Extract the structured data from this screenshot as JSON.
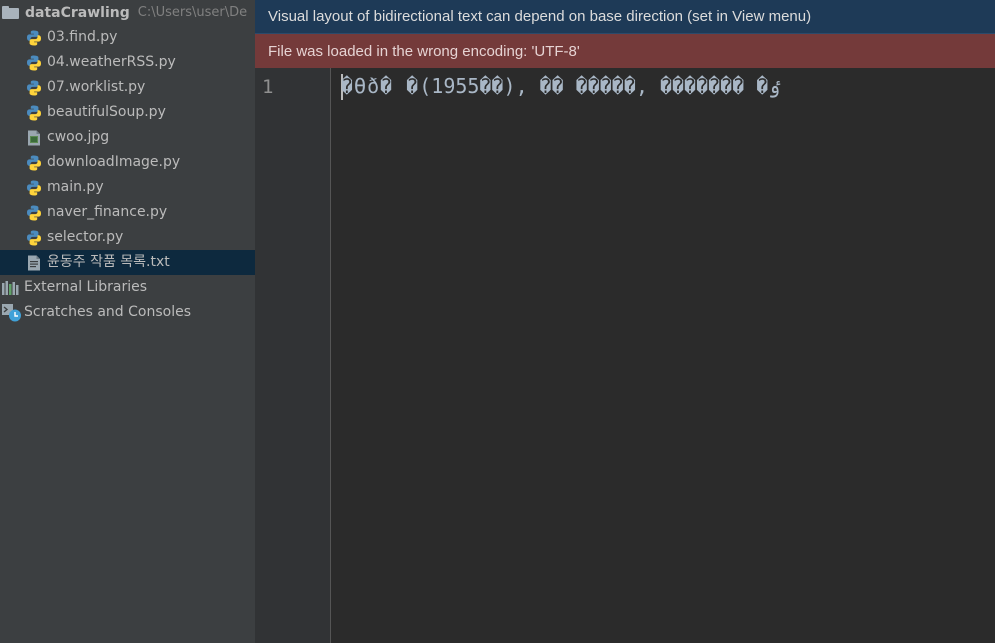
{
  "project": {
    "root_name": "dataCrawling",
    "root_path": "C:\\Users\\user\\De",
    "files": [
      {
        "name": "03.find.py",
        "type": "python"
      },
      {
        "name": "04.weatherRSS.py",
        "type": "python"
      },
      {
        "name": "07.worklist.py",
        "type": "python"
      },
      {
        "name": "beautifulSoup.py",
        "type": "python"
      },
      {
        "name": "cwoo.jpg",
        "type": "image"
      },
      {
        "name": "downloadImage.py",
        "type": "python"
      },
      {
        "name": "main.py",
        "type": "python"
      },
      {
        "name": "naver_finance.py",
        "type": "python"
      },
      {
        "name": "selector.py",
        "type": "python"
      },
      {
        "name": "윤동주 작품 목록.txt",
        "type": "text",
        "selected": true
      }
    ],
    "external_libraries": "External Libraries",
    "scratches": "Scratches and Consoles"
  },
  "editor": {
    "info_banner": "Visual layout of bidirectional text can depend on base direction (set in View menu)",
    "error_banner": "File was loaded in the wrong encoding: 'UTF-8'",
    "line_number": "1",
    "line_1": "�ϴð� �ٶ� ������� ,����� �� ,(��1955)"
  },
  "colors": {
    "sidebar_bg": "#3c3f41",
    "selection_bg": "#0d293e",
    "info_banner_bg": "#1e3a57",
    "error_banner_bg": "#743a3a",
    "editor_bg": "#2b2b2b",
    "python_blue": "#4b8bbe",
    "python_yellow": "#ffd43b"
  }
}
